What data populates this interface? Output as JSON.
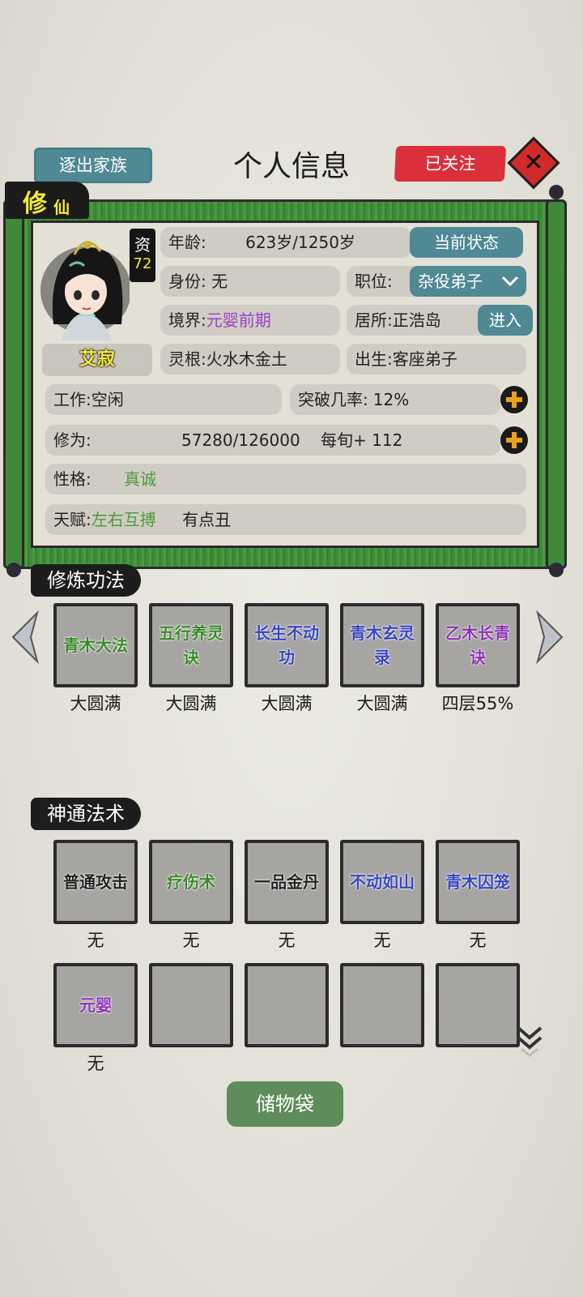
{
  "header": {
    "expel_label": "逐出家族",
    "title": "个人信息",
    "follow_label": "已关注",
    "close_icon": "close-icon"
  },
  "panel_tag": {
    "big": "修",
    "small": "仙"
  },
  "character": {
    "aptitude_label": "资",
    "aptitude_value": "72",
    "name": "艾寂",
    "age_label": "年龄:",
    "age_value": "623岁/1250岁",
    "status_button": "当前状态",
    "identity_label": "身份:",
    "identity_value": "无",
    "position_label": "职位:",
    "position_value": "杂役弟子",
    "realm_label": "境界:",
    "realm_value": "元婴前期",
    "residence_label": "居所:",
    "residence_value": "正浩岛",
    "enter_button": "进入",
    "root_label": "灵根:",
    "root_value": "火水木金土",
    "origin_label": "出生:",
    "origin_value": "客座弟子",
    "job_label": "工作:",
    "job_value": "空闲",
    "breakthrough_label": "突破几率:",
    "breakthrough_value": "12%",
    "cultivation_label": "修为:",
    "cultivation_value": "57280/126000",
    "cultivation_rate": "每旬+ 112",
    "personality_label": "性格:",
    "personality_value": "真诚",
    "talent_label": "天赋:",
    "talent_1": "左右互搏",
    "talent_2": "有点丑"
  },
  "techniques": {
    "title": "修炼功法",
    "items": [
      {
        "name": "青木大法",
        "status": "大圆满",
        "color": "green"
      },
      {
        "name": "五行养灵诀",
        "status": "大圆满",
        "color": "green"
      },
      {
        "name": "长生不动功",
        "status": "大圆满",
        "color": "blue"
      },
      {
        "name": "青木玄灵录",
        "status": "大圆满",
        "color": "blue"
      },
      {
        "name": "乙木长青诀",
        "status": "四层55%",
        "color": "purple"
      }
    ]
  },
  "skills": {
    "title": "神通法术",
    "items": [
      {
        "name": "普通攻击",
        "status": "无",
        "color": "black"
      },
      {
        "name": "疗伤术",
        "status": "无",
        "color": "green"
      },
      {
        "name": "一品金丹",
        "status": "无",
        "color": "black"
      },
      {
        "name": "不动如山",
        "status": "无",
        "color": "blue"
      },
      {
        "name": "青木囚笼",
        "status": "无",
        "color": "blue"
      },
      {
        "name": "元婴",
        "status": "无",
        "color": "purple"
      },
      {
        "name": "",
        "status": ""
      },
      {
        "name": "",
        "status": ""
      },
      {
        "name": "",
        "status": ""
      },
      {
        "name": "",
        "status": ""
      }
    ]
  },
  "bag_label": "储物袋",
  "colors": {
    "teal": "#4e8994",
    "red": "#d9303a",
    "green_frame": "#3f8e3a",
    "purple": "#9a3fc9",
    "aptitude_yellow": "#f2ea3a"
  }
}
